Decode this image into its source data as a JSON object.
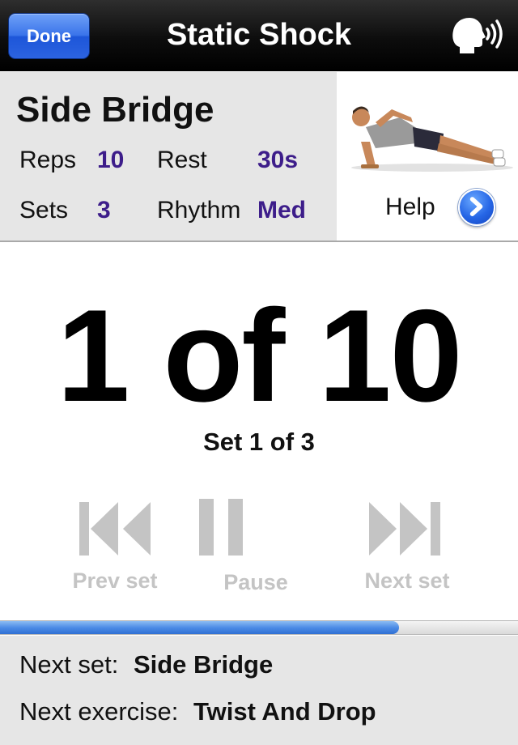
{
  "navbar": {
    "done_label": "Done",
    "title": "Static Shock",
    "speaker_icon": "speaking-head-icon"
  },
  "exercise": {
    "name": "Side Bridge",
    "reps_label": "Reps",
    "reps_value": "10",
    "rest_label": "Rest",
    "rest_value": "30s",
    "sets_label": "Sets",
    "sets_value": "3",
    "rhythm_label": "Rhythm",
    "rhythm_value": "Med",
    "help_label": "Help",
    "image_icon": "side-bridge-illustration"
  },
  "counter": {
    "text": "1 of 10",
    "set_text": "Set 1 of 3"
  },
  "controls": {
    "prev_label": "Prev set",
    "pause_label": "Pause",
    "next_label": "Next set"
  },
  "progress": {
    "fraction": 0.77
  },
  "upcoming": {
    "next_set_label": "Next set:",
    "next_set_value": "Side Bridge",
    "next_exercise_label": "Next exercise:",
    "next_exercise_value": "Twist And Drop"
  },
  "colors": {
    "accent_blue": "#2c63e0",
    "value_purple": "#3d1d8a",
    "disabled_gray": "#c4c4c4"
  }
}
